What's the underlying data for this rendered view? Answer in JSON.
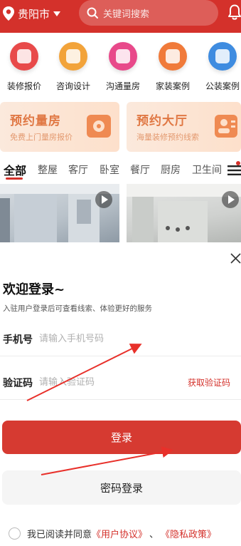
{
  "header": {
    "city": "贵阳市",
    "search_placeholder": "关键词搜索",
    "bg_color": "#d4312b"
  },
  "categories": [
    {
      "label": "装修报价",
      "icon": "quote-icon",
      "color": "#e84a4a"
    },
    {
      "label": "咨询设计",
      "icon": "chat-icon",
      "color": "#f2a33a"
    },
    {
      "label": "沟通量房",
      "icon": "measure-icon",
      "color": "#e8498a"
    },
    {
      "label": "家装案例",
      "icon": "house-icon",
      "color": "#f07a3a"
    },
    {
      "label": "公装案例",
      "icon": "building-icon",
      "color": "#3f8ce0"
    }
  ],
  "promos": [
    {
      "title": "预约量房",
      "subtitle": "免费上门量房报价",
      "icon": "tape-measure-icon"
    },
    {
      "title": "预约大厅",
      "subtitle": "海量装修预约线索",
      "icon": "contacts-icon"
    }
  ],
  "tabs": [
    "全部",
    "整屋",
    "客厅",
    "卧室",
    "餐厅",
    "厨房",
    "卫生间"
  ],
  "login": {
    "title": "欢迎登录~",
    "subtitle": "入驻用户登录后可查看线索、体验更好的服务",
    "phone_label": "手机号",
    "phone_placeholder": "请输入手机号码",
    "code_label": "验证码",
    "code_placeholder": "请输入验证码",
    "get_code": "获取验证码",
    "login_button": "登录",
    "password_login": "密码登录",
    "agree_prefix": "我已阅读并同意",
    "user_agreement": "《用户协议》",
    "separator": "、",
    "privacy_policy": "《隐私政策》",
    "accent_color": "#d63a31"
  }
}
